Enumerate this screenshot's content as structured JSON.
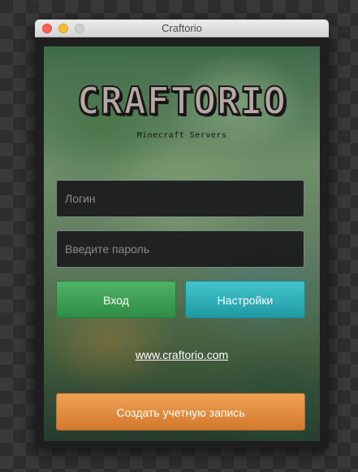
{
  "window": {
    "title": "Craftorio"
  },
  "logo": {
    "text": "CRAFTORIO",
    "tagline": "Minecraft Servers"
  },
  "login_form": {
    "login_placeholder": "Логин",
    "login_value": "",
    "password_placeholder": "Введите пароль",
    "password_value": ""
  },
  "buttons": {
    "enter_label": "Вход",
    "settings_label": "Настройки",
    "create_account_label": "Создать учетную запись"
  },
  "links": {
    "website": "www.craftorio.com"
  },
  "colors": {
    "enter_button": "#3fa556",
    "settings_button": "#2fb3bc",
    "create_button": "#e38d42",
    "close_light": "#fc5f57",
    "minimize_light": "#fdbc2e",
    "zoom_light": "#cfcfcf"
  }
}
